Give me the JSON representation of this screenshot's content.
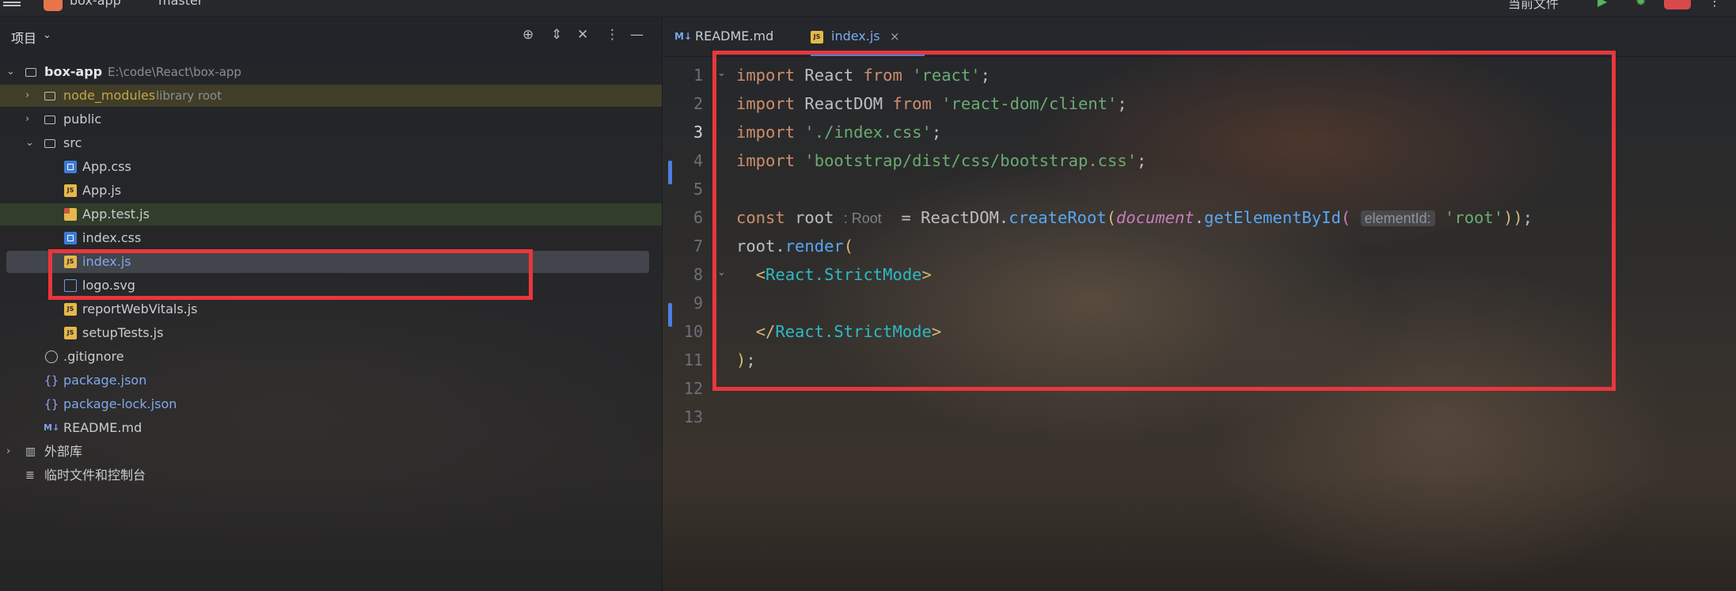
{
  "titlebar": {
    "project": "box-app",
    "branch": "master",
    "right_label": "当前文件"
  },
  "project_panel": {
    "title": "项目",
    "tree": [
      {
        "name": "box-app",
        "path": "E:\\code\\React\\box-app",
        "type": "folder",
        "expanded": true
      },
      {
        "name": "node_modules",
        "note": "library root",
        "type": "folder"
      },
      {
        "name": "public",
        "type": "folder"
      },
      {
        "name": "src",
        "type": "folder",
        "expanded": true
      },
      {
        "name": "App.css",
        "type": "css"
      },
      {
        "name": "App.js",
        "type": "js"
      },
      {
        "name": "App.test.js",
        "type": "test"
      },
      {
        "name": "index.css",
        "type": "css"
      },
      {
        "name": "index.js",
        "type": "js",
        "selected": true
      },
      {
        "name": "logo.svg",
        "type": "svg"
      },
      {
        "name": "reportWebVitals.js",
        "type": "js"
      },
      {
        "name": "setupTests.js",
        "type": "js"
      },
      {
        "name": ".gitignore",
        "type": "ignore"
      },
      {
        "name": "package.json",
        "type": "json"
      },
      {
        "name": "package-lock.json",
        "type": "json"
      },
      {
        "name": "README.md",
        "type": "md"
      },
      {
        "name": "外部库",
        "type": "lib"
      },
      {
        "name": "临时文件和控制台",
        "type": "scratch"
      }
    ]
  },
  "editor": {
    "tabs": [
      {
        "icon": "M↓",
        "label": "README.md"
      },
      {
        "icon": "JS",
        "label": "index.js",
        "active": true,
        "close": "×"
      }
    ],
    "line_numbers": [
      "1",
      "2",
      "3",
      "4",
      "5",
      "6",
      "7",
      "8",
      "9",
      "10",
      "11",
      "12",
      "13"
    ],
    "code": {
      "l1": {
        "kw": "import",
        "name": "React",
        "from": "from",
        "str": "'react'",
        "end": ";"
      },
      "l2": {
        "kw": "import",
        "name": "ReactDOM",
        "from": "from",
        "str": "'react-dom/client'",
        "end": ";"
      },
      "l3": {
        "kw": "import",
        "str": "'./index.css'",
        "end": ";"
      },
      "l4": {
        "kw": "import",
        "str": "'bootstrap/dist/css/bootstrap.css'",
        "end": ";"
      },
      "l6": {
        "kw": "const",
        "name": "root",
        "type_hint": ": Root",
        "eq": " = ReactDOM.",
        "fn1": "createRoot",
        "p1": "(",
        "obj": "document",
        "dot": ".",
        "fn2": "getElementById",
        "p2": "(",
        "param_hint": "elementId:",
        "str": "'root'",
        "p3": "))",
        "end": ";"
      },
      "l7": {
        "obj": "root.",
        "fn": "render",
        "p": "("
      },
      "l8": {
        "open": "<",
        "tag": "React.StrictMode",
        "close": ">"
      },
      "l10": {
        "open": "</",
        "tag": "React.StrictMode",
        "close": ">"
      },
      "l11": {
        "p": ")",
        "end": ";"
      }
    }
  }
}
